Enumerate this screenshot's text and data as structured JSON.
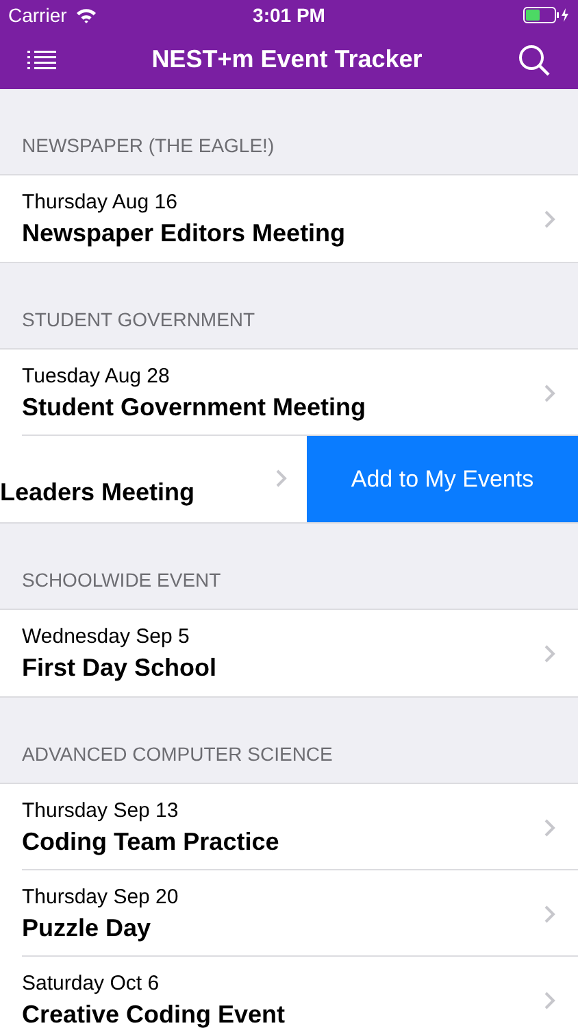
{
  "status_bar": {
    "carrier": "Carrier",
    "time": "3:01 PM"
  },
  "nav_bar": {
    "title": "NEST+m Event Tracker"
  },
  "sections": [
    {
      "header": "NEWSPAPER (THE EAGLE!)",
      "rows": [
        {
          "kind": "event",
          "date": "Thursday Aug 16",
          "title": "Newspaper Editors Meeting"
        }
      ]
    },
    {
      "header": "STUDENT GOVERNMENT",
      "rows": [
        {
          "kind": "event",
          "date": "Tuesday Aug 28",
          "title": "Student Government Meeting"
        },
        {
          "kind": "swiped",
          "title": "Leaders Meeting",
          "action": "Add to My Events"
        }
      ]
    },
    {
      "header": "SCHOOLWIDE EVENT",
      "rows": [
        {
          "kind": "event",
          "date": "Wednesday Sep 5",
          "title": "First Day School"
        }
      ]
    },
    {
      "header": "ADVANCED COMPUTER SCIENCE",
      "rows": [
        {
          "kind": "event",
          "date": "Thursday Sep 13",
          "title": "Coding Team Practice"
        },
        {
          "kind": "event",
          "date": "Thursday Sep 20",
          "title": "Puzzle Day"
        },
        {
          "kind": "event",
          "date": "Saturday Oct 6",
          "title": "Creative Coding Event"
        }
      ]
    }
  ]
}
